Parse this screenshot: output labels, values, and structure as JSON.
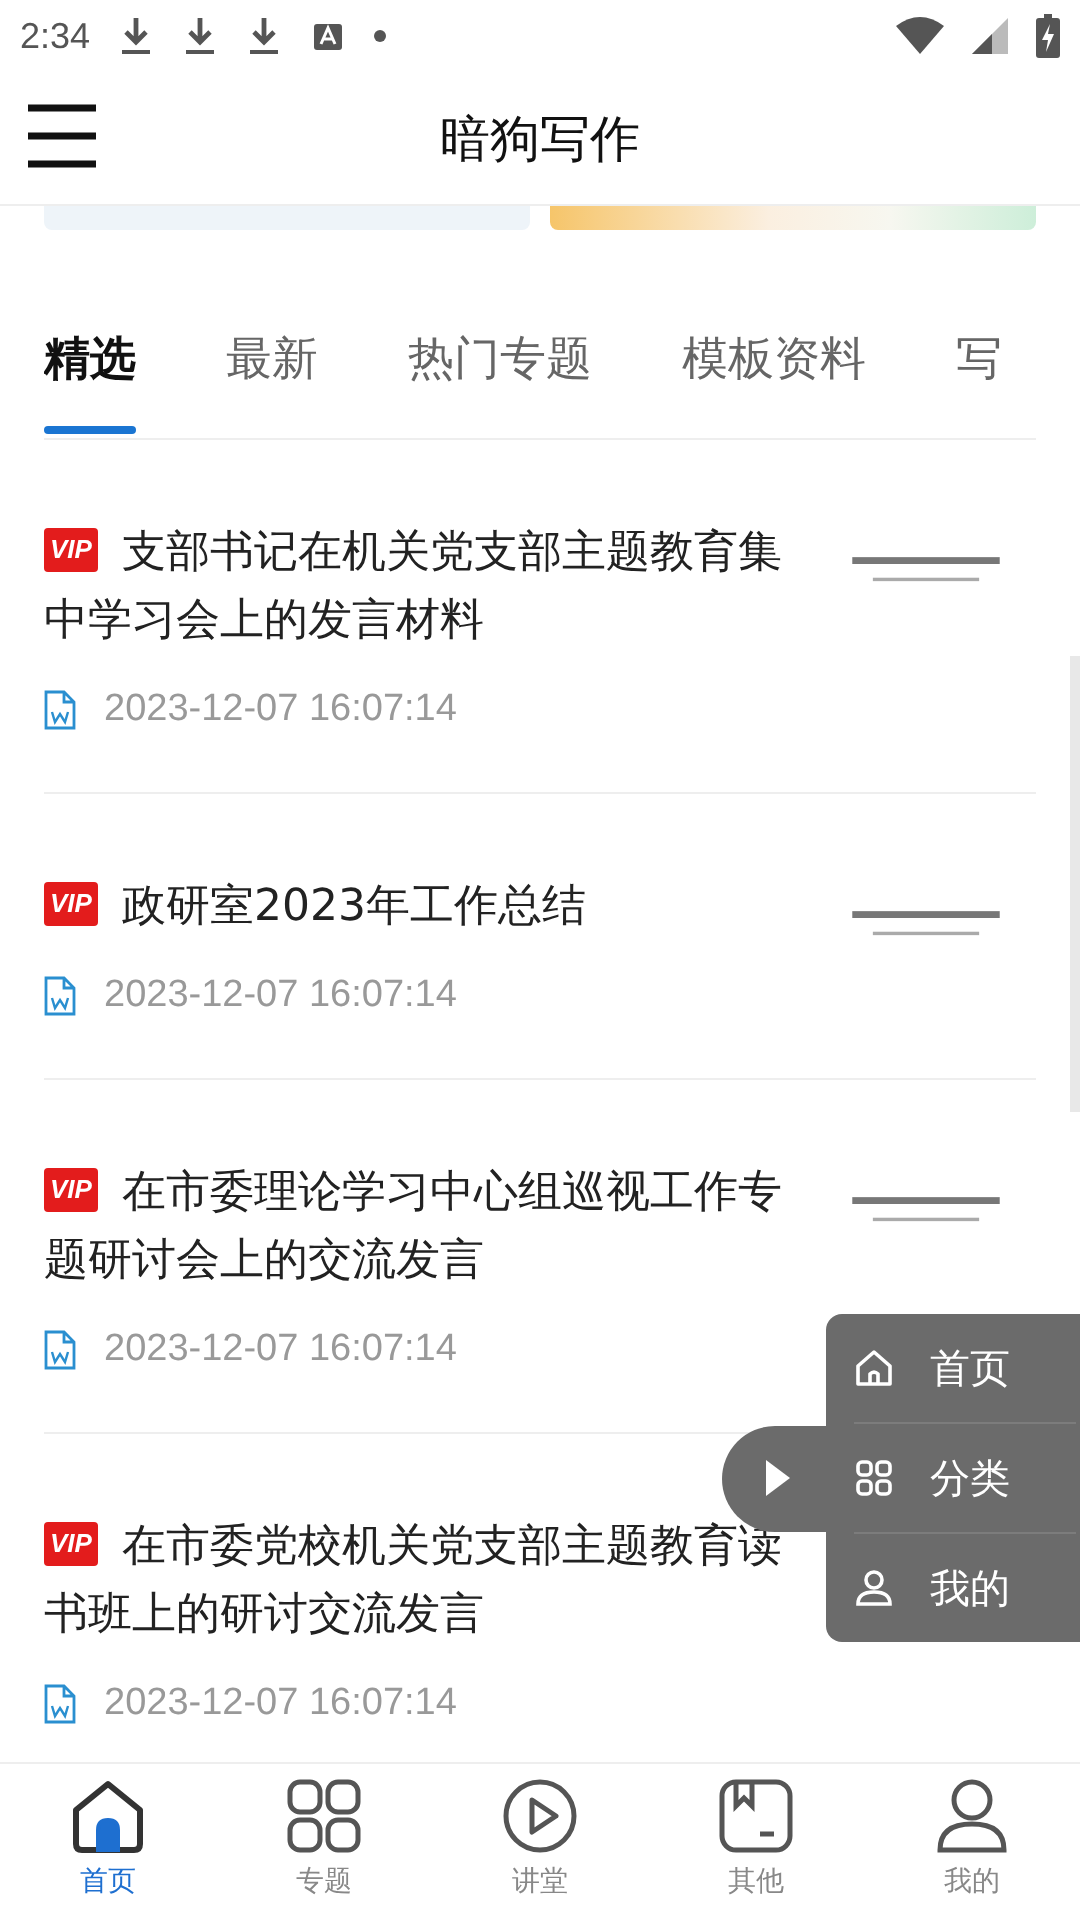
{
  "status_bar": {
    "time": "2:34"
  },
  "app_bar": {
    "title": "暗狗写作"
  },
  "tabs": [
    {
      "label": "精选",
      "selected": true
    },
    {
      "label": "最新",
      "selected": false
    },
    {
      "label": "热门专题",
      "selected": false
    },
    {
      "label": "模板资料",
      "selected": false
    },
    {
      "label": "写",
      "selected": false
    }
  ],
  "articles": [
    {
      "badge": "VIP",
      "title": "支部书记在机关党支部主题教育集中学习会上的发言材料",
      "date": "2023-12-07 16:07:14"
    },
    {
      "badge": "VIP",
      "title": "政研室2023年工作总结",
      "date": "2023-12-07 16:07:14"
    },
    {
      "badge": "VIP",
      "title": "在市委理论学习中心组巡视工作专题研讨会上的交流发言",
      "date": "2023-12-07 16:07:14"
    },
    {
      "badge": "VIP",
      "title": "在市委党校机关党支部主题教育读书班上的研讨交流发言",
      "date": "2023-12-07 16:07:14"
    }
  ],
  "float_menu": {
    "expanded": true,
    "items": [
      {
        "label": "首页"
      },
      {
        "label": "分类"
      },
      {
        "label": "我的"
      }
    ]
  },
  "bottom_nav": [
    {
      "label": "首页",
      "selected": true
    },
    {
      "label": "专题",
      "selected": false
    },
    {
      "label": "讲堂",
      "selected": false
    },
    {
      "label": "其他",
      "selected": false
    },
    {
      "label": "我的",
      "selected": false
    }
  ]
}
